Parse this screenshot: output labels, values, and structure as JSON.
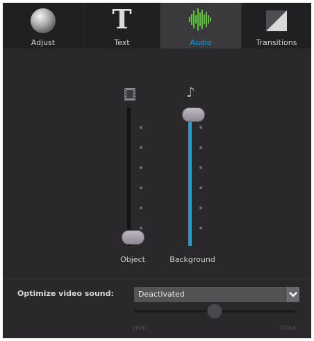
{
  "tabs": [
    {
      "label": "Adjust",
      "icon": "sphere-icon",
      "active": false
    },
    {
      "label": "Text",
      "icon": "text-t-icon",
      "glyph": "T",
      "active": false
    },
    {
      "label": "Audio",
      "icon": "audio-waveform-icon",
      "active": true
    },
    {
      "label": "Transitions",
      "icon": "transition-diagonal-icon",
      "active": false
    }
  ],
  "mixer": {
    "object": {
      "label": "Object",
      "icon": "film-strip-icon",
      "level": 0.0
    },
    "background": {
      "label": "Background",
      "icon": "music-note-icon",
      "glyph": "♪",
      "level": 1.0
    }
  },
  "optimize": {
    "label": "Optimize video sound:",
    "dropdown_value": "Deactivated",
    "min_label": "min",
    "max_label": "max",
    "level": 0.5
  },
  "colors": {
    "accent": "#1e9ae0",
    "audio_icon": "#5dc43a",
    "background": "#282628"
  }
}
